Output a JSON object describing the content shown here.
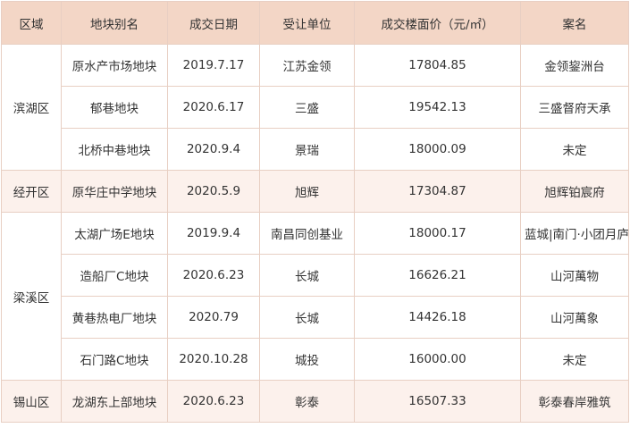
{
  "table": {
    "headers": [
      "区域",
      "地块别名",
      "成交日期",
      "受让单位",
      "成交楼面价（元/㎡）",
      "案名"
    ],
    "groups": [
      {
        "district": "滨湖区",
        "shaded": false,
        "rows": [
          [
            "原水产市场地块",
            "2019.7.17",
            "江苏金领",
            "17804.85",
            "金领鋆洲台"
          ],
          [
            "郁巷地块",
            "2020.6.17",
            "三盛",
            "19542.13",
            "三盛督府天承"
          ],
          [
            "北桥中巷地块",
            "2020.9.4",
            "景瑞",
            "18000.09",
            "未定"
          ]
        ]
      },
      {
        "district": "经开区",
        "shaded": true,
        "rows": [
          [
            "原华庄中学地块",
            "2020.5.9",
            "旭辉",
            "17304.87",
            "旭辉铂宸府"
          ]
        ]
      },
      {
        "district": "梁溪区",
        "shaded": false,
        "rows": [
          [
            "太湖广场E地块",
            "2019.9.4",
            "南昌同创基业",
            "18000.17",
            "蓝城|南门·小团月庐"
          ],
          [
            "造船厂C地块",
            "2020.6.23",
            "长城",
            "16626.21",
            "山河萬物"
          ],
          [
            "黄巷热电厂地块",
            "2020.79",
            "长城",
            "14426.18",
            "山河萬象"
          ],
          [
            "石门路C地块",
            "2020.10.28",
            "城投",
            "16000.00",
            "未定"
          ]
        ]
      },
      {
        "district": "锡山区",
        "shaded": true,
        "rows": [
          [
            "龙湖东上部地块",
            "2020.6.23",
            "彰泰",
            "16507.33",
            "彰泰春岸雅筑"
          ]
        ]
      }
    ]
  }
}
